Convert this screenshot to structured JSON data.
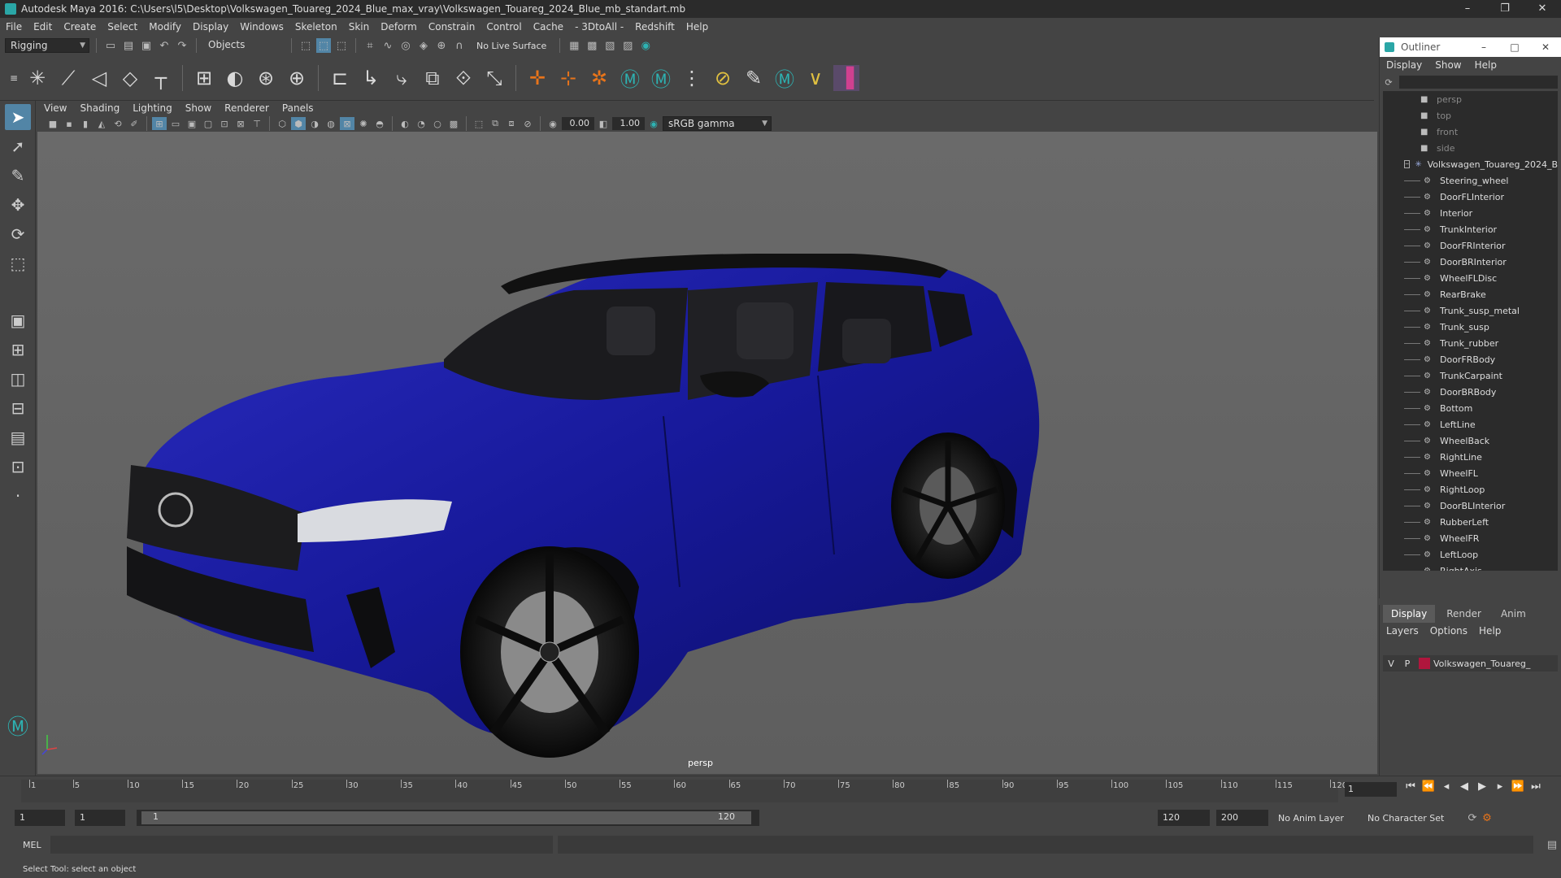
{
  "window": {
    "title": "Autodesk Maya 2016: C:\\Users\\l5\\Desktop\\Volkswagen_Touareg_2024_Blue_max_vray\\Volkswagen_Touareg_2024_Blue_mb_standart.mb",
    "min": "–",
    "max": "❐",
    "close": "✕"
  },
  "menubar": [
    "File",
    "Edit",
    "Create",
    "Select",
    "Modify",
    "Display",
    "Windows",
    "Skeleton",
    "Skin",
    "Deform",
    "Constrain",
    "Control",
    "Cache",
    "- 3DtoAll -",
    "Redshift",
    "Help"
  ],
  "shelf": {
    "mode": "Rigging",
    "select_mode": "Objects",
    "live_surface": "No Live Surface"
  },
  "viewport": {
    "menus": [
      "View",
      "Shading",
      "Lighting",
      "Show",
      "Renderer",
      "Panels"
    ],
    "exposure": "0.00",
    "gamma": "1.00",
    "color_space": "sRGB gamma",
    "camera_label": "persp"
  },
  "outliner": {
    "title": "Outliner",
    "menu": [
      "Display",
      "Show",
      "Help"
    ],
    "cameras": [
      "persp",
      "top",
      "front",
      "side"
    ],
    "root": "Volkswagen_Touareg_2024_B",
    "items": [
      "Steering_wheel",
      "DoorFLInterior",
      "Interior",
      "TrunkInterior",
      "DoorFRInterior",
      "DoorBRInterior",
      "WheelFLDisc",
      "RearBrake",
      "Trunk_susp_metal",
      "Trunk_susp",
      "Trunk_rubber",
      "DoorFRBody",
      "TrunkCarpaint",
      "DoorBRBody",
      "Bottom",
      "LeftLine",
      "WheelBack",
      "RightLine",
      "WheelFL",
      "RightLoop",
      "DoorBLInterior",
      "RubberLeft",
      "WheelFR",
      "LeftLoop",
      "RightAxis"
    ]
  },
  "layers": {
    "tabs": [
      "Display",
      "Render",
      "Anim"
    ],
    "menu": [
      "Layers",
      "Options",
      "Help"
    ],
    "row": {
      "v": "V",
      "p": "P",
      "name": "Volkswagen_Touareg_",
      "color": "#b0163d"
    }
  },
  "timeline": {
    "ticks": [
      "1",
      "5",
      "10",
      "15",
      "20",
      "25",
      "30",
      "35",
      "40",
      "45",
      "50",
      "55",
      "60",
      "65",
      "70",
      "75",
      "80",
      "85",
      "90",
      "95",
      "100",
      "105",
      "110",
      "115",
      "120"
    ],
    "current": "1"
  },
  "range": {
    "start": "1",
    "start2": "1",
    "slider_start": "1",
    "slider_end": "120",
    "end": "120",
    "end2": "200",
    "anim_layer": "No Anim Layer",
    "char_set": "No Character Set"
  },
  "command": {
    "label": "MEL"
  },
  "status": "Select Tool: select an object",
  "colors": {
    "car_body": "#17199a",
    "accent": "#5285a6"
  }
}
